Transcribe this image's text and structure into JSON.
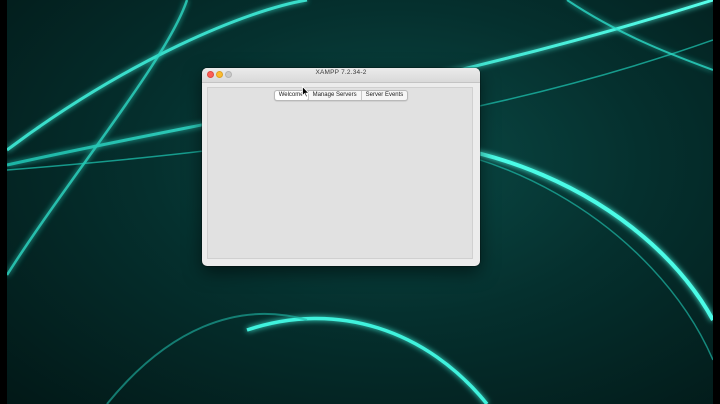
{
  "window": {
    "title": "XAMPP 7.2.34-2"
  },
  "tabs": [
    {
      "label": "Welcome",
      "active": true
    },
    {
      "label": "Manage Servers",
      "active": false
    },
    {
      "label": "Server Events",
      "active": false
    }
  ],
  "colors": {
    "wallpaper_glow": "#38f0dc",
    "close": "#fc5f57",
    "minimize": "#fdbc2e",
    "zoom": "#c9c9c9"
  }
}
